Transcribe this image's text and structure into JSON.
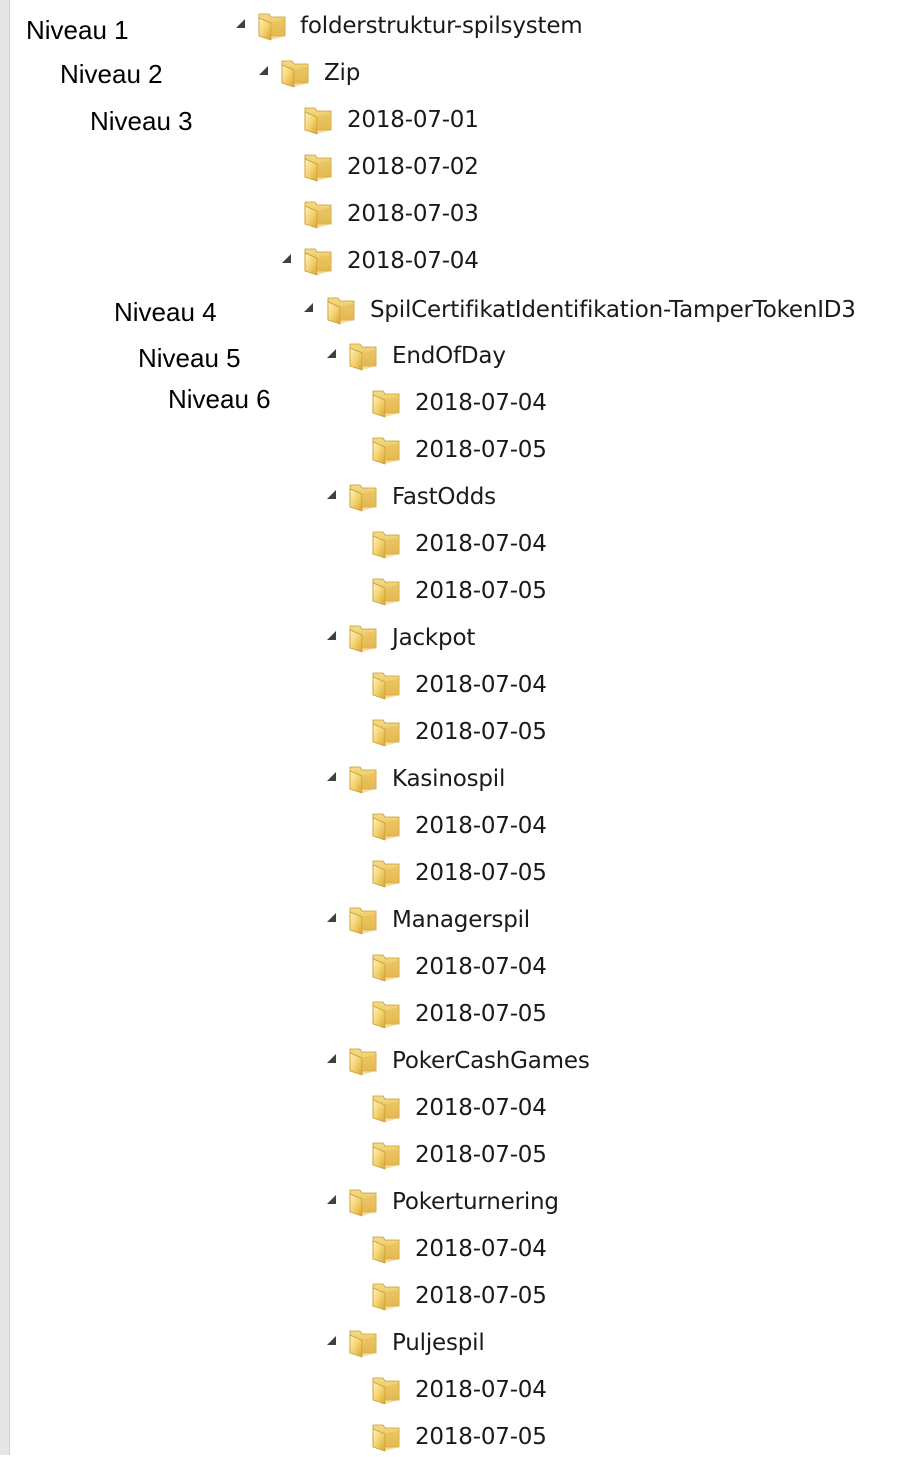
{
  "levels": {
    "level1": "Niveau 1",
    "level2": "Niveau 2",
    "level3": "Niveau 3",
    "level4": "Niveau 4",
    "level5": "Niveau 5",
    "level6": "Niveau 6"
  },
  "tree": {
    "icons": {
      "folder": "folder-icon",
      "expand": "expanded-arrow-icon"
    },
    "root": "folderstruktur-spilsystem",
    "zip": "Zip",
    "dates": [
      "2018-07-01",
      "2018-07-02",
      "2018-07-03",
      "2018-07-04"
    ],
    "certificate": "SpilCertifikatIdentifikation-TamperTokenID3",
    "games": [
      {
        "name": "EndOfDay",
        "dates": [
          "2018-07-04",
          "2018-07-05"
        ]
      },
      {
        "name": "FastOdds",
        "dates": [
          "2018-07-04",
          "2018-07-05"
        ]
      },
      {
        "name": "Jackpot",
        "dates": [
          "2018-07-04",
          "2018-07-05"
        ]
      },
      {
        "name": "Kasinospil",
        "dates": [
          "2018-07-04",
          "2018-07-05"
        ]
      },
      {
        "name": "Managerspil",
        "dates": [
          "2018-07-04",
          "2018-07-05"
        ]
      },
      {
        "name": "PokerCashGames",
        "dates": [
          "2018-07-04",
          "2018-07-05"
        ]
      },
      {
        "name": "Pokerturnering",
        "dates": [
          "2018-07-04",
          "2018-07-05"
        ]
      },
      {
        "name": "Puljespil",
        "dates": [
          "2018-07-04",
          "2018-07-05"
        ]
      }
    ]
  }
}
